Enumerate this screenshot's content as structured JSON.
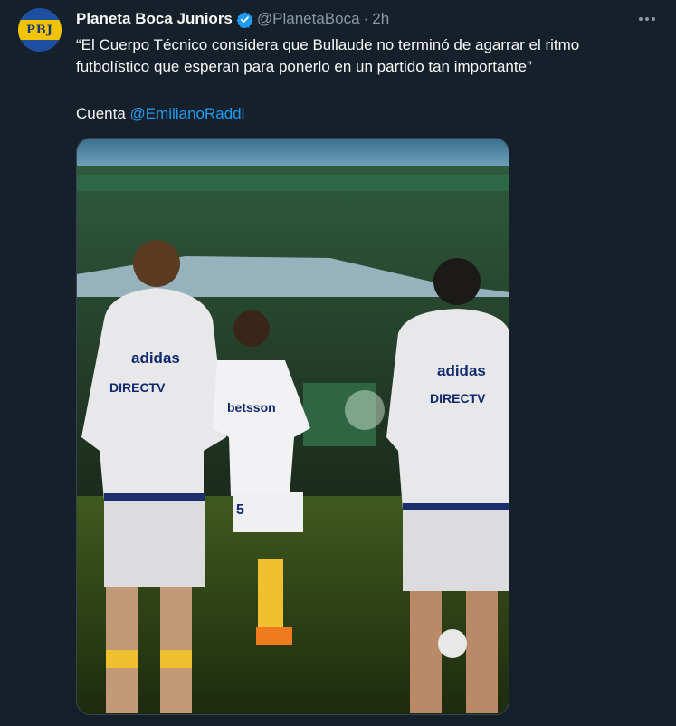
{
  "tweet": {
    "avatar_text": "PBJ",
    "display_name": "Planeta Boca Juniors",
    "handle": "@PlanetaBoca",
    "separator": "·",
    "time": "2h",
    "text": "“El Cuerpo Técnico considera que Bullaude no terminó de agarrar el ritmo futbolístico que esperan para ponerlo en un partido tan importante”",
    "credit_prefix": "Cuenta ",
    "credit_mention": "@EmilianoRaddi",
    "media": {
      "player_left_brand": "adidas",
      "player_left_sponsor": "DIRECTV",
      "player_center_sponsor": "betsson",
      "player_center_number": "5",
      "player_right_brand": "adidas",
      "player_right_sponsor": "DIRECTV"
    }
  },
  "colors": {
    "background": "#15202b",
    "primary_text": "#f7f9f9",
    "secondary_text": "#8b98a5",
    "link": "#1d9bf0",
    "verified": "#1d9bf0"
  }
}
